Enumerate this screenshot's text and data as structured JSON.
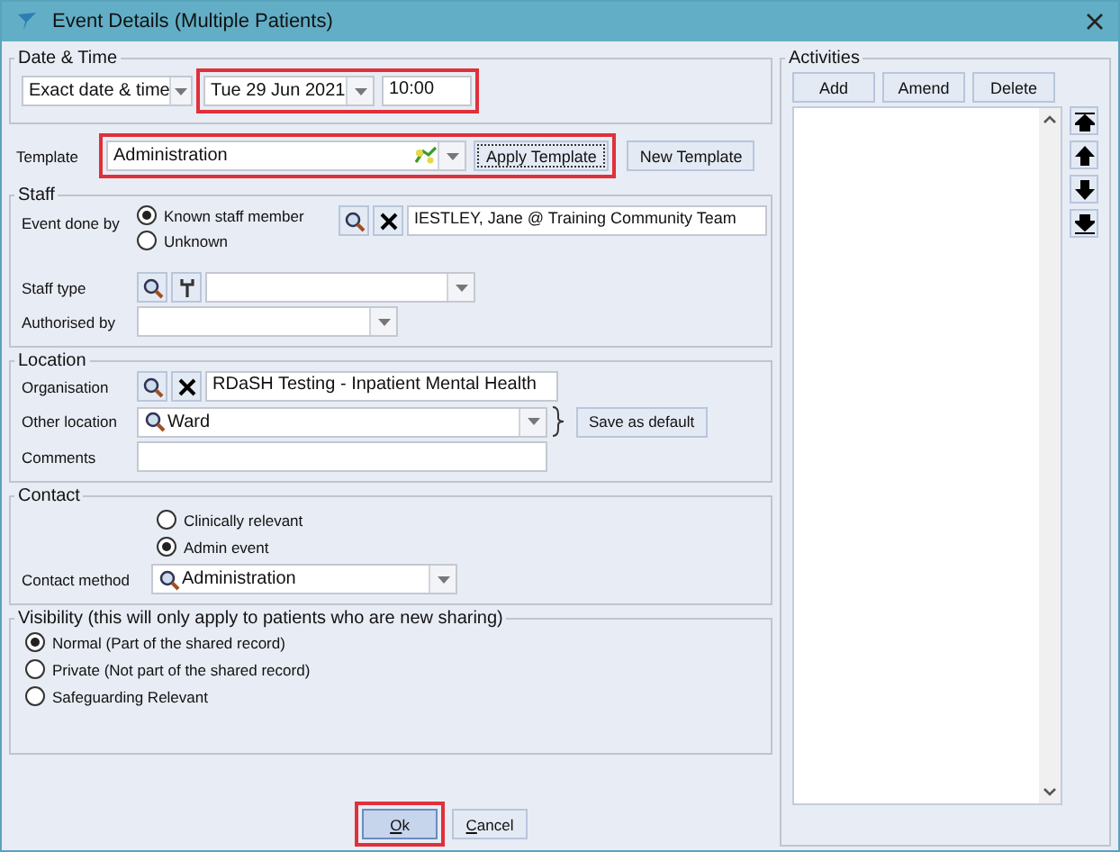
{
  "window": {
    "title": "Event Details (Multiple Patients)"
  },
  "date_time": {
    "legend": "Date & Time",
    "mode": "Exact date & time",
    "date": "Tue 29 Jun 2021",
    "time": "10:00",
    "highlighted": true
  },
  "template": {
    "label": "Template",
    "value": "Administration",
    "highlighted": true,
    "buttons": [
      {
        "label": "Apply Template",
        "focused": true
      },
      {
        "label": "New Template",
        "focused": false
      }
    ]
  },
  "staff": {
    "legend": "Staff",
    "event_done_by": {
      "label": "Event done by",
      "value": "IESTLEY, Jane @ Training Community Team",
      "options": [
        {
          "label": "Known staff member",
          "selected": true
        },
        {
          "label": "Unknown",
          "selected": false
        }
      ]
    },
    "staff_type": {
      "label": "Staff type"
    },
    "authorised_by": {
      "label": "Authorised by"
    }
  },
  "location": {
    "legend": "Location",
    "organisation": {
      "label": "Organisation",
      "value": "RDaSH Testing - Inpatient Mental Health"
    },
    "other_location": {
      "label": "Other location",
      "value": "Ward"
    },
    "save_button": "Save as default",
    "comments": {
      "label": "Comments"
    }
  },
  "contact": {
    "legend": "Contact",
    "options": [
      {
        "label": "Clinically relevant",
        "selected": false
      },
      {
        "label": "Admin event",
        "selected": true
      }
    ],
    "method": {
      "label": "Contact method",
      "value": "Administration"
    }
  },
  "visibility": {
    "legend": "Visibility (this will only apply to patients who are new sharing)",
    "options": [
      {
        "label": "Normal (Part of the shared record)",
        "selected": true
      },
      {
        "label": "Private (Not part of the shared record)",
        "selected": false
      },
      {
        "label": "Safeguarding Relevant",
        "selected": false
      }
    ]
  },
  "footer_buttons": [
    {
      "label": "Ok",
      "highlighted": true,
      "mnemonic": true
    },
    {
      "label": "Cancel",
      "highlighted": false,
      "mnemonic": true
    }
  ],
  "activities": {
    "legend": "Activities",
    "buttons": [
      "Add",
      "Amend",
      "Delete"
    ]
  }
}
